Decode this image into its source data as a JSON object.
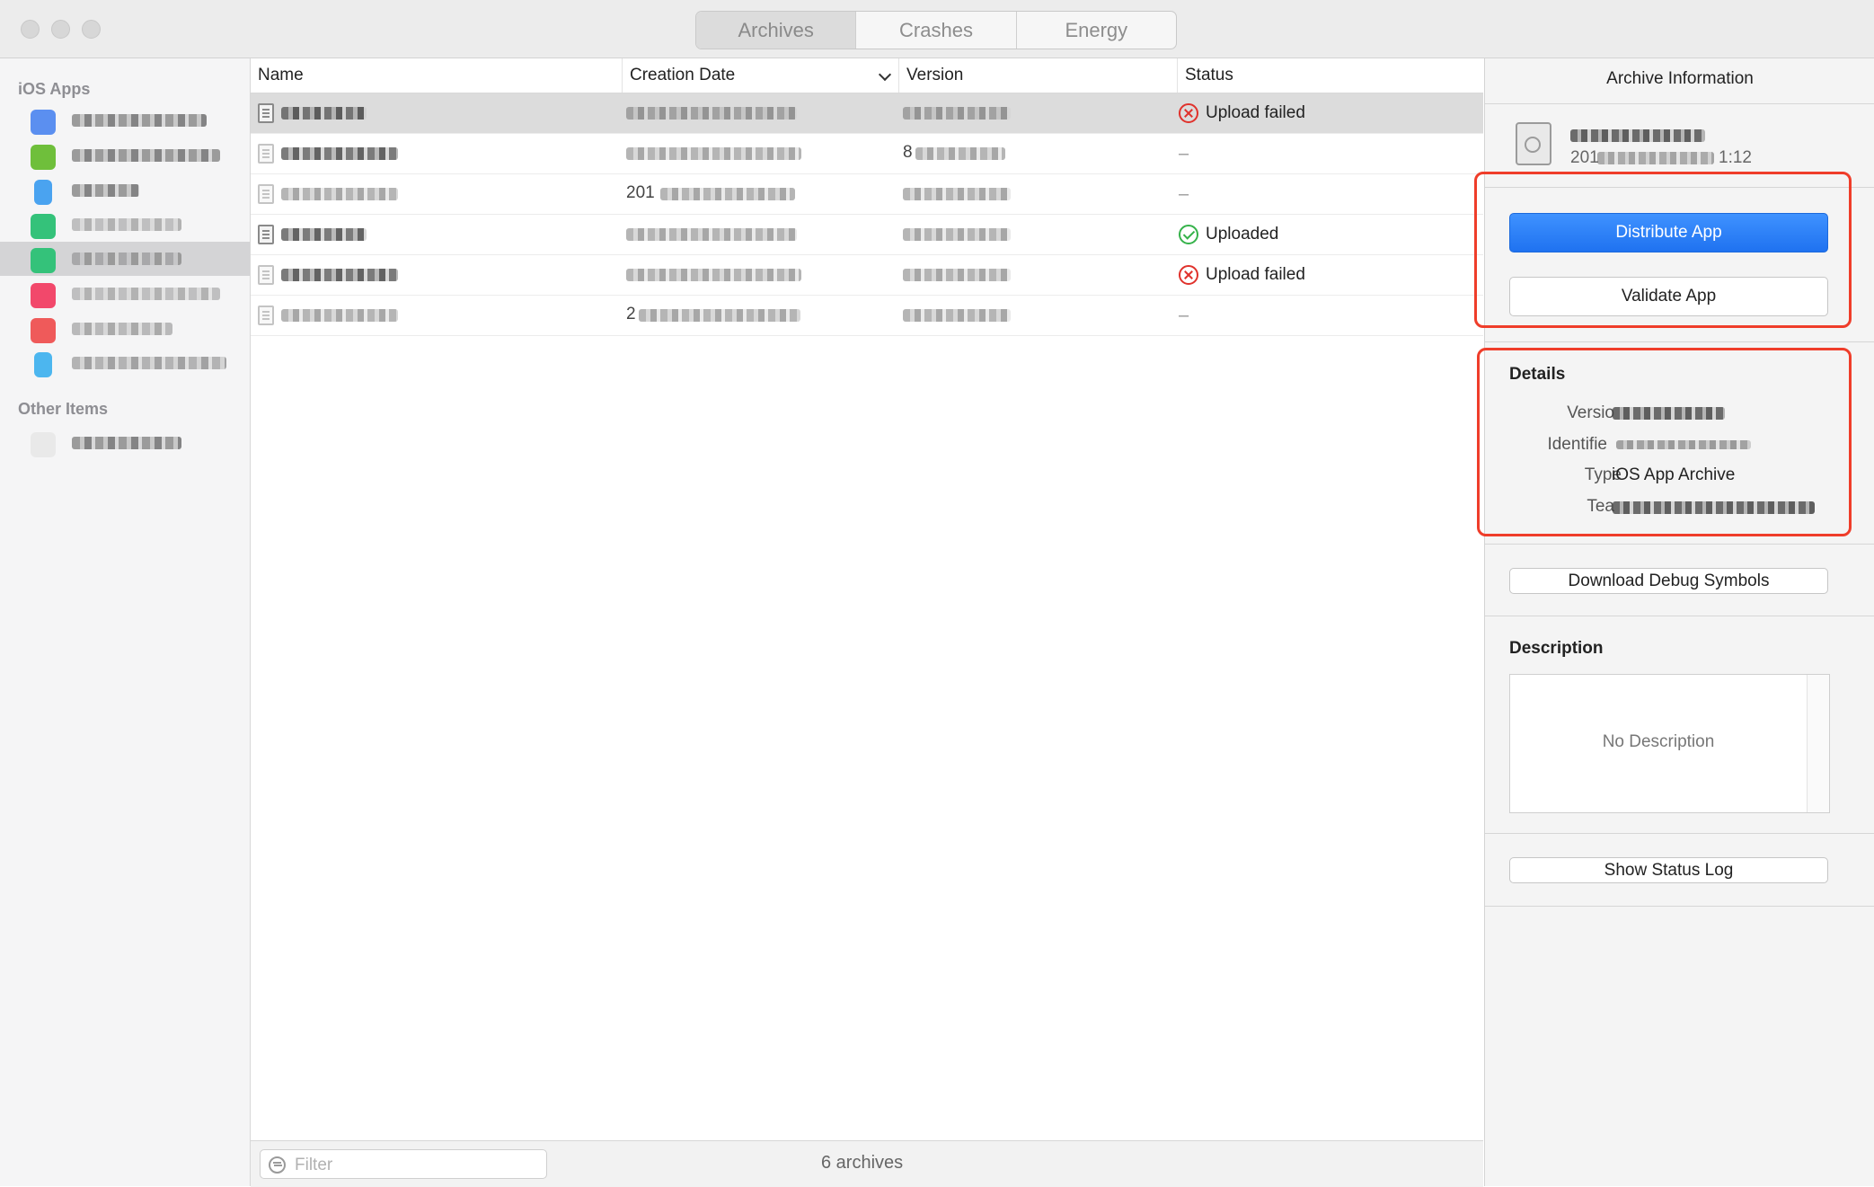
{
  "window": {
    "tabs": [
      {
        "label": "Archives",
        "active": true
      },
      {
        "label": "Crashes",
        "active": false
      },
      {
        "label": "Energy",
        "active": false
      }
    ]
  },
  "sidebar": {
    "section_ios": "iOS Apps",
    "section_other": "Other Items",
    "app_icon_colors": [
      "#5b8ff0",
      "#6fbf3b",
      "#4aa3f0",
      "#34c27a",
      "#34c27a",
      "#f2486b",
      "#ef5a5a",
      "#4cb6ef"
    ],
    "selected_index": 4
  },
  "table": {
    "columns": {
      "name": "Name",
      "creation_date": "Creation Date",
      "version": "Version",
      "status": "Status"
    },
    "rows": [
      {
        "date_prefix": "",
        "version_prefix": "",
        "status": "Upload failed",
        "status_kind": "failed"
      },
      {
        "date_prefix": "",
        "version_prefix": "8",
        "status": "–",
        "status_kind": "none"
      },
      {
        "date_prefix": "201",
        "version_prefix": "",
        "status": "–",
        "status_kind": "none"
      },
      {
        "date_prefix": "",
        "version_prefix": "",
        "status": "Uploaded",
        "status_kind": "uploaded"
      },
      {
        "date_prefix": "",
        "version_prefix": "",
        "status": "Upload failed",
        "status_kind": "failed"
      },
      {
        "date_prefix": "2",
        "version_prefix": "",
        "status": "–",
        "status_kind": "none"
      }
    ]
  },
  "footer": {
    "filter_placeholder": "Filter",
    "archive_count": "6 archives"
  },
  "panel": {
    "title": "Archive Information",
    "time_suffix": "1:12",
    "date_prefix": "201",
    "distribute_label": "Distribute App",
    "validate_label": "Validate App",
    "details_heading": "Details",
    "details": {
      "version_label": "Versio",
      "identifier_label": "Identifie",
      "type_label": "Type",
      "type_value": "iOS App Archive",
      "team_label": "Tea"
    },
    "download_symbols_label": "Download Debug Symbols",
    "description_heading": "Description",
    "description_placeholder": "No Description",
    "status_log_label": "Show Status Log",
    "highlight_color": "#ef3d2a",
    "accent_color": "#1f72f0"
  }
}
